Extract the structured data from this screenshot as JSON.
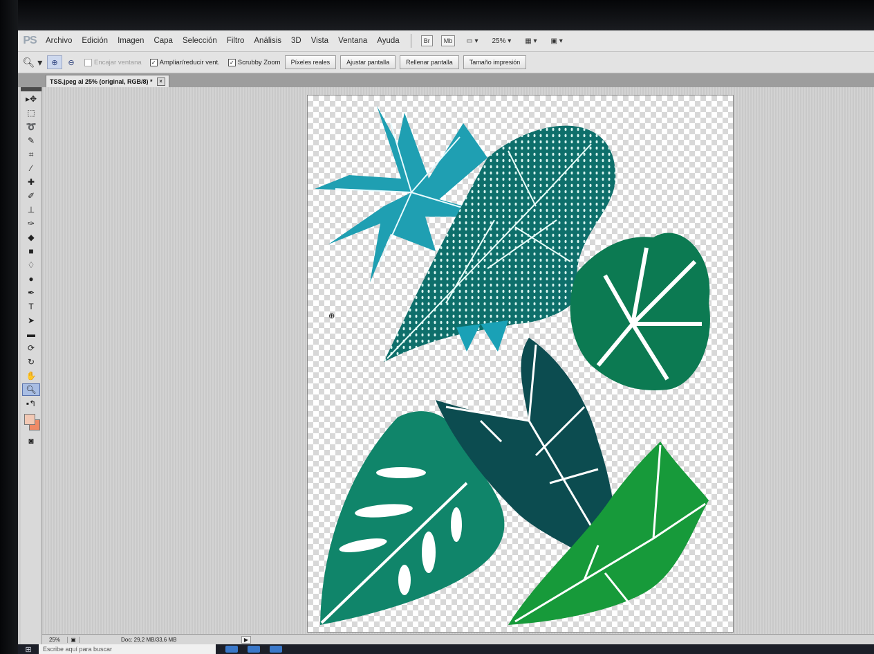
{
  "app": {
    "logo": "PS"
  },
  "menu": {
    "items": [
      "Archivo",
      "Edición",
      "Imagen",
      "Capa",
      "Selección",
      "Filtro",
      "Análisis",
      "3D",
      "Vista",
      "Ventana",
      "Ayuda"
    ],
    "br_label": "Br",
    "mb_label": "Mb",
    "zoom_value": "25%"
  },
  "options": {
    "resize_windows_label": "Encajar ventana",
    "zoom_resize_label": "Ampliar/reducir vent.",
    "scrubby_zoom_label": "Scrubby Zoom",
    "buttons": [
      "Píxeles reales",
      "Ajustar pantalla",
      "Rellenar pantalla",
      "Tamaño impresión"
    ]
  },
  "document": {
    "tab_title": "TSS.jpeg al 25% (original, RGB/8) *",
    "close_glyph": "×"
  },
  "status": {
    "zoom": "25%",
    "doc_info": "Doc: 29,2 MB/33,6 MB",
    "arrow": "▶"
  },
  "taskbar": {
    "search_placeholder": "Escribe aquí para buscar"
  },
  "colors": {
    "foreground": "#f2c8b4",
    "background": "#f08a66"
  }
}
